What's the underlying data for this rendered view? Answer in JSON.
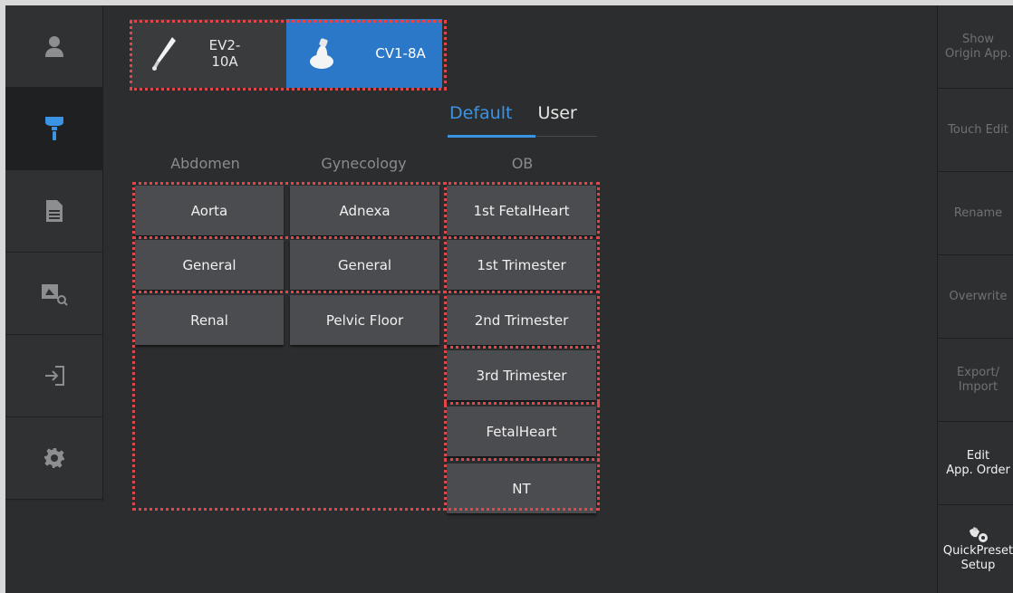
{
  "probes": [
    {
      "label": "EV2-10A",
      "active": false
    },
    {
      "label": "CV1-8A",
      "active": true
    }
  ],
  "tabs": [
    {
      "label": "Default",
      "active": true
    },
    {
      "label": "User",
      "active": false
    }
  ],
  "columns": {
    "abdomen": {
      "title": "Abdomen",
      "items": [
        "Aorta",
        "General",
        "Renal"
      ]
    },
    "gynecology": {
      "title": "Gynecology",
      "items": [
        "Adnexa",
        "General",
        "Pelvic Floor"
      ]
    },
    "ob": {
      "title": "OB",
      "items": [
        "1st FetalHeart",
        "1st Trimester",
        "2nd Trimester",
        "3rd Trimester",
        "FetalHeart",
        "NT"
      ]
    }
  },
  "right_panel": [
    {
      "label": "Show\nOrigin App.",
      "enabled": false
    },
    {
      "label": "Touch Edit",
      "enabled": false
    },
    {
      "label": "Rename",
      "enabled": false
    },
    {
      "label": "Overwrite",
      "enabled": false
    },
    {
      "label": "Export/\nImport",
      "enabled": false
    },
    {
      "label": "Edit\nApp. Order",
      "enabled": true
    },
    {
      "label": "QuickPreset\nSetup",
      "enabled": true
    }
  ],
  "sidebar_icons": [
    "user-icon",
    "probe-icon",
    "document-icon",
    "image-search-icon",
    "login-icon",
    "gear-icon"
  ],
  "colors": {
    "accent": "#2c78c8",
    "tab_active": "#3b93e4",
    "highlight_outline": "#e0474a"
  }
}
